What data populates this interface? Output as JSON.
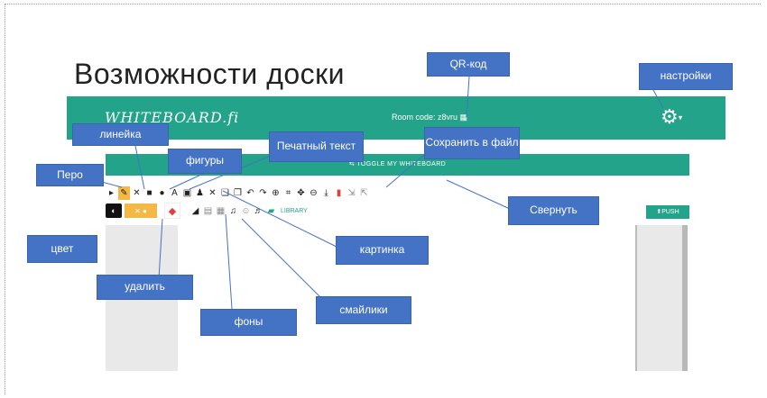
{
  "slide": {
    "title": "Возможности доски"
  },
  "whiteboard": {
    "logo": "WHITEBOARD.fi",
    "room_code": "Room code: z8vru ▦",
    "settings_icon": "gear-icon",
    "toggle_label": "⇆ TOGGLE MY WHITEBOARD",
    "library_label": "LIBRARY",
    "push_label": "⬆PUSH"
  },
  "callouts": {
    "qr": "QR-код",
    "settings": "настройки",
    "ruler": "линейка",
    "shapes": "фигуры",
    "text": "Печатный текст",
    "save": "Сохранить в файл",
    "pen": "Перо",
    "collapse": "Свернуть",
    "color": "цвет",
    "picture": "картинка",
    "delete": "удалить",
    "emoji": "смайлики",
    "backgrounds": "фоны"
  }
}
